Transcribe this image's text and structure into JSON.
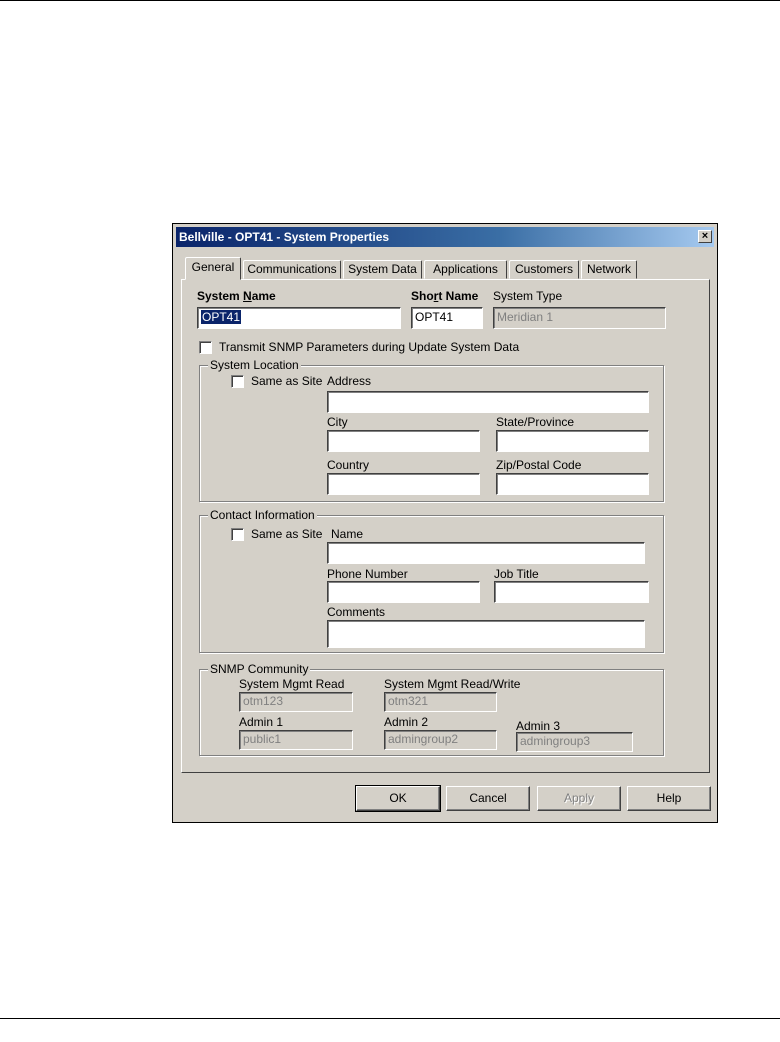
{
  "window": {
    "title": "Bellville - OPT41 - System Properties",
    "close_glyph": "×"
  },
  "tabs": [
    "General",
    "Communications",
    "System Data",
    "Applications",
    "Customers",
    "Network"
  ],
  "general": {
    "system_name_label_pre": "System ",
    "system_name_label_key": "N",
    "system_name_label_post": "ame",
    "system_name_value": "OPT41",
    "short_name_label_pre": "Sho",
    "short_name_label_key": "r",
    "short_name_label_post": "t Name",
    "short_name_value": "OPT41",
    "system_type_label": "System Type",
    "system_type_value": "Meridian 1",
    "transmit_snmp_label": "Transmit SNMP Parameters during Update System Data",
    "transmit_snmp_checked": false
  },
  "location": {
    "legend": "System Location",
    "same_as_site_label": "Same as Site",
    "same_as_site_checked": false,
    "address_label": "Address",
    "address_value": "",
    "city_label": "City",
    "city_value": "",
    "state_label": "State/Province",
    "state_value": "",
    "country_label": "Country",
    "country_value": "",
    "zip_label": "Zip/Postal Code",
    "zip_value": ""
  },
  "contact": {
    "legend": "Contact Information",
    "same_as_site_label": "Same as Site",
    "same_as_site_checked": false,
    "name_label": "Name",
    "name_value": "",
    "phone_label": "Phone Number",
    "phone_value": "",
    "job_title_label": "Job Title",
    "job_title_value": "",
    "comments_label": "Comments",
    "comments_value": ""
  },
  "snmp": {
    "legend": "SNMP Community",
    "read_label": "System Mgmt Read",
    "read_value": "otm123",
    "readwrite_label": "System Mgmt Read/Write",
    "readwrite_value": "otm321",
    "admin1_label": "Admin 1",
    "admin1_value": "public1",
    "admin2_label": "Admin 2",
    "admin2_value": "admingroup2",
    "admin3_label": "Admin 3",
    "admin3_value": "admingroup3"
  },
  "buttons": {
    "ok": "OK",
    "cancel": "Cancel",
    "apply": "Apply",
    "help": "Help"
  },
  "colors": {
    "titlebar_start": "#0a246a",
    "titlebar_end": "#a6caf0",
    "dialog_face": "#d4d0c8"
  }
}
